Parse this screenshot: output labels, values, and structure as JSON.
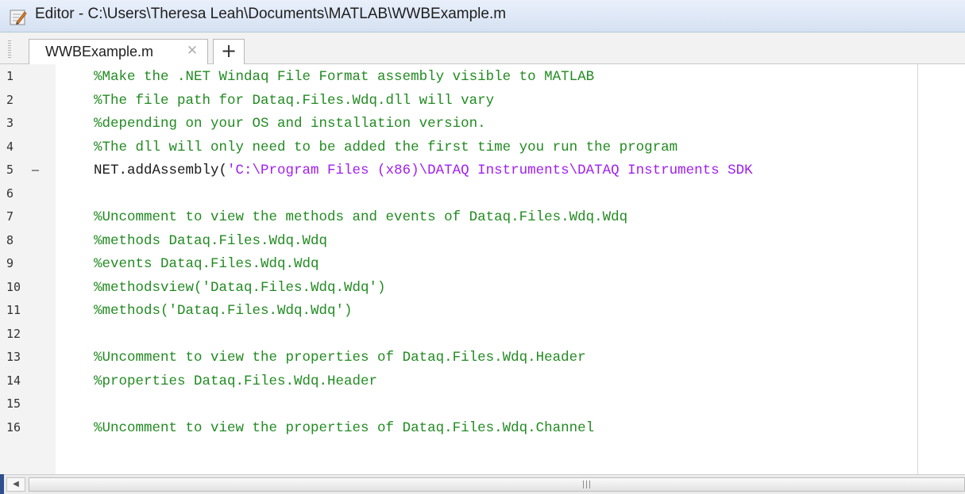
{
  "window": {
    "title": "Editor - C:\\Users\\Theresa Leah\\Documents\\MATLAB\\WWBExample.m",
    "icon": "matlab-editor-icon"
  },
  "tabs": [
    {
      "label": "WWBExample.m",
      "close_icon": "close-icon"
    }
  ],
  "new_tab_label": "+",
  "lines": [
    {
      "num": "1",
      "mark": "",
      "segments": [
        {
          "cls": "comment",
          "text": "%Make the .NET Windaq File Format assembly visible to MATLAB"
        }
      ]
    },
    {
      "num": "2",
      "mark": "",
      "segments": [
        {
          "cls": "comment",
          "text": "%The file path for Dataq.Files.Wdq.dll will vary"
        }
      ]
    },
    {
      "num": "3",
      "mark": "",
      "segments": [
        {
          "cls": "comment",
          "text": "%depending on your OS and installation version."
        }
      ]
    },
    {
      "num": "4",
      "mark": "",
      "segments": [
        {
          "cls": "comment",
          "text": "%The dll will only need to be added the first time you run the program"
        }
      ]
    },
    {
      "num": "5",
      "mark": "–",
      "segments": [
        {
          "cls": "code",
          "text": "NET.addAssembly("
        },
        {
          "cls": "str",
          "text": "'C:\\Program Files (x86)\\DATAQ Instruments\\DATAQ Instruments SDK"
        }
      ]
    },
    {
      "num": "6",
      "mark": "",
      "segments": []
    },
    {
      "num": "7",
      "mark": "",
      "segments": [
        {
          "cls": "comment",
          "text": "%Uncomment to view the methods and events of Dataq.Files.Wdq.Wdq"
        }
      ]
    },
    {
      "num": "8",
      "mark": "",
      "segments": [
        {
          "cls": "comment",
          "text": "%methods Dataq.Files.Wdq.Wdq"
        }
      ]
    },
    {
      "num": "9",
      "mark": "",
      "segments": [
        {
          "cls": "comment",
          "text": "%events Dataq.Files.Wdq.Wdq"
        }
      ]
    },
    {
      "num": "10",
      "mark": "",
      "segments": [
        {
          "cls": "comment",
          "text": "%methodsview('Dataq.Files.Wdq.Wdq')"
        }
      ]
    },
    {
      "num": "11",
      "mark": "",
      "segments": [
        {
          "cls": "comment",
          "text": "%methods('Dataq.Files.Wdq.Wdq')"
        }
      ]
    },
    {
      "num": "12",
      "mark": "",
      "segments": []
    },
    {
      "num": "13",
      "mark": "",
      "segments": [
        {
          "cls": "comment",
          "text": "%Uncomment to view the properties of Dataq.Files.Wdq.Header"
        }
      ]
    },
    {
      "num": "14",
      "mark": "",
      "segments": [
        {
          "cls": "comment",
          "text": "%properties Dataq.Files.Wdq.Header"
        }
      ]
    },
    {
      "num": "15",
      "mark": "",
      "segments": []
    },
    {
      "num": "16",
      "mark": "",
      "segments": [
        {
          "cls": "comment",
          "text": "%Uncomment to view the properties of Dataq.Files.Wdq.Channel"
        }
      ]
    }
  ],
  "scrollbar": {
    "left_arrow": "◀",
    "grip_icon": "scroll-grip-icon"
  },
  "colors": {
    "comment": "#228b22",
    "code": "#1a1a1a",
    "string": "#a020f0",
    "gutter_bg": "#f3f3f3"
  }
}
